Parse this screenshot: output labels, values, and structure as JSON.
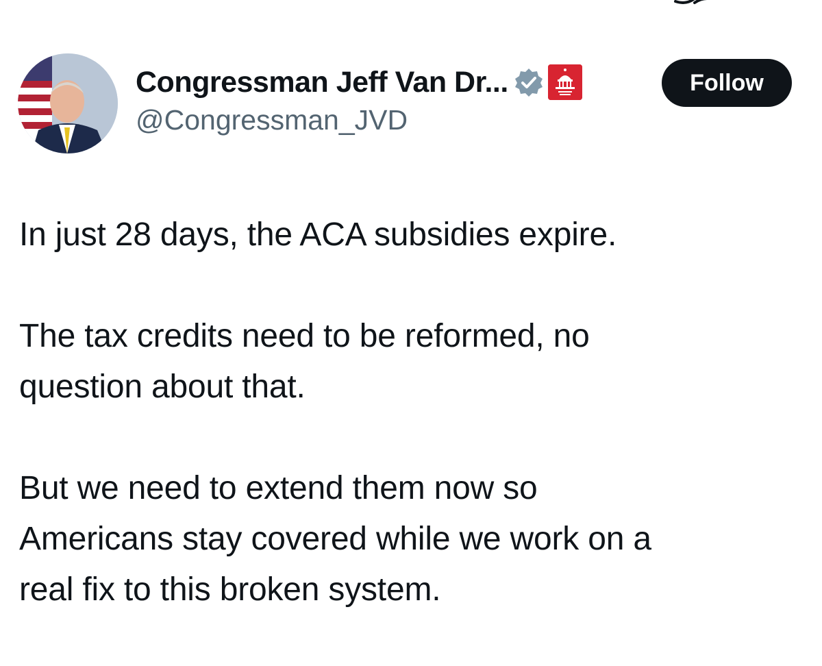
{
  "tweet": {
    "author": {
      "display_name": "Congressman Jeff Van Dr...",
      "handle": "@Congressman_JVD",
      "avatar_icon": "avatar-photo",
      "verified_badge_icon": "verified-check-icon",
      "verified_badge_color": "#829aab",
      "affiliation_badge_icon": "house-gop-capitol-icon",
      "affiliation_badge_color": "#d82431"
    },
    "follow_label": "Follow",
    "paragraphs": [
      {
        "lines": [
          "In just 28 days, the ACA subsidies expire."
        ]
      },
      {
        "lines": [
          "The tax credits need to be reformed, no",
          "question about that."
        ]
      },
      {
        "lines": [
          "But we need to extend them now so",
          "Americans stay covered while we work on a",
          "real fix to this broken system."
        ]
      }
    ]
  },
  "colors": {
    "text_primary": "#0f1419",
    "text_secondary": "#536471",
    "button_bg": "#0f1419",
    "button_text": "#ffffff",
    "background": "#ffffff"
  }
}
